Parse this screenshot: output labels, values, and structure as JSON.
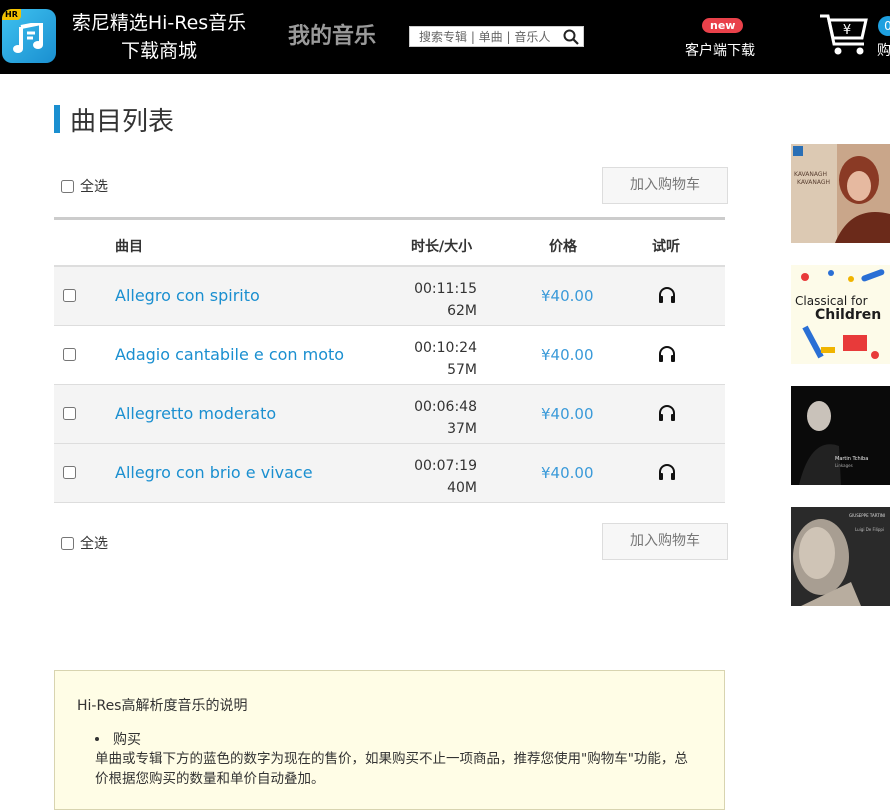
{
  "header": {
    "logo_badge": "HR",
    "brand_line1": "索尼精选Hi-Res音乐",
    "brand_line2": "下载商城",
    "my_music": "我的音乐",
    "search_placeholder": "搜索专辑 | 单曲 | 音乐人",
    "new_badge": "new",
    "client_download": "客户端下载",
    "cart_count": "0",
    "cart_label": "购",
    "cart_symbol": "¥"
  },
  "page": {
    "title": "曲目列表",
    "select_all": "全选",
    "add_to_cart": "加入购物车"
  },
  "table": {
    "headers": {
      "track": "曲目",
      "duration_size": "时长/大小",
      "price": "价格",
      "listen": "试听"
    },
    "rows": [
      {
        "name": "Allegro con spirito",
        "duration": "00:11:15",
        "size": "62M",
        "price": "¥40.00"
      },
      {
        "name": "Adagio cantabile e con moto",
        "duration": "00:10:24",
        "size": "57M",
        "price": "¥40.00"
      },
      {
        "name": "Allegretto moderato",
        "duration": "00:06:48",
        "size": "37M",
        "price": "¥40.00"
      },
      {
        "name": "Allegro con brio e vivace",
        "duration": "00:07:19",
        "size": "40M",
        "price": "¥40.00"
      }
    ]
  },
  "albums": {
    "kavanagh_line1": "KAVANAGH",
    "kavanagh_line2": "KAVANAGH",
    "classical_line1": "Classical for",
    "classical_line2": "Children",
    "tchika_name": "Martin Tchiba",
    "tchika_title": "Linkages",
    "tartini_name": "GIUSEPPE TARTINI",
    "tartini_sub": "Luigi De Filippi"
  },
  "info": {
    "title": "Hi-Res高解析度音乐的说明",
    "item": "购买",
    "description": "单曲或专辑下方的蓝色的数字为现在的售价，如果购买不止一项商品，推荐您使用\"购物车\"功能，总价根据您购买的数量和单价自动叠加。"
  }
}
